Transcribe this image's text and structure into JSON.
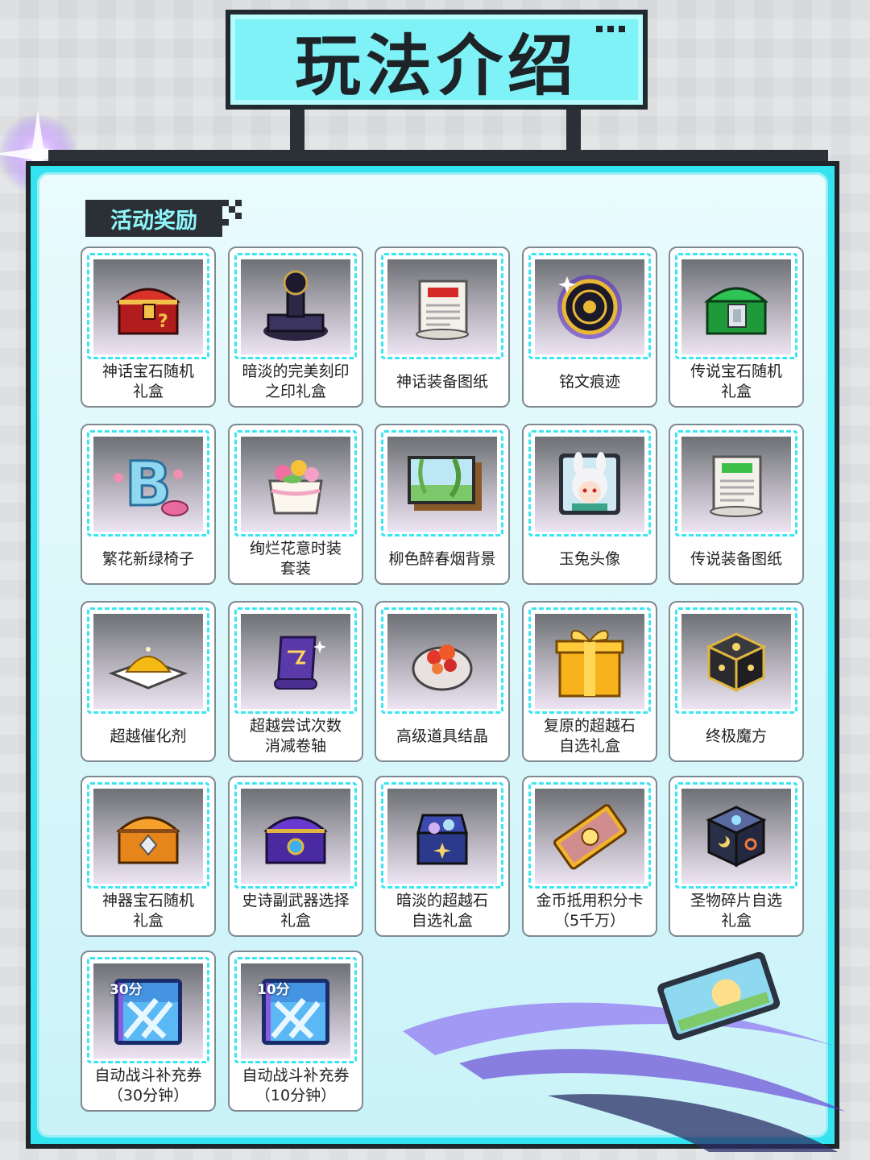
{
  "header": {
    "title": "玩法介绍"
  },
  "section": {
    "title": "活动奖励"
  },
  "rewards": [
    {
      "name": "神话宝石随机\n礼盒",
      "icon": "red-gem-chest-icon"
    },
    {
      "name": "暗淡的完美刻印\n之印礼盒",
      "icon": "dark-seal-stamp-icon"
    },
    {
      "name": "神话装备图纸",
      "icon": "red-blueprint-scroll-icon"
    },
    {
      "name": "铭文痕迹",
      "icon": "golden-inscription-orb-icon"
    },
    {
      "name": "传说宝石随机\n礼盒",
      "icon": "green-gem-chest-icon"
    },
    {
      "name": "繁花新绿椅子",
      "icon": "flower-letter-chair-icon"
    },
    {
      "name": "绚烂花意时装\n套装",
      "icon": "flower-cake-outfit-icon"
    },
    {
      "name": "柳色醉春烟背景",
      "icon": "willow-landscape-background-icon"
    },
    {
      "name": "玉兔头像",
      "icon": "jade-rabbit-avatar-icon"
    },
    {
      "name": "传说装备图纸",
      "icon": "green-blueprint-scroll-icon"
    },
    {
      "name": "超越催化剂",
      "icon": "golden-catalyst-powder-icon"
    },
    {
      "name": "超越尝试次数\n消减卷轴",
      "icon": "purple-scroll-icon"
    },
    {
      "name": "高级道具结晶",
      "icon": "item-crystal-icon"
    },
    {
      "name": "复原的超越石\n自选礼盒",
      "icon": "golden-gift-box-icon"
    },
    {
      "name": "终极魔方",
      "icon": "ultimate-cube-icon"
    },
    {
      "name": "神器宝石随机\n礼盒",
      "icon": "orange-gem-chest-icon"
    },
    {
      "name": "史诗副武器选择\n礼盒",
      "icon": "purple-weapon-chest-icon"
    },
    {
      "name": "暗淡的超越石\n自选礼盒",
      "icon": "dark-stone-box-icon"
    },
    {
      "name": "金币抵用积分卡\n（5千万）",
      "icon": "gold-coupon-card-icon"
    },
    {
      "name": "圣物碎片自选\n礼盒",
      "icon": "relic-fragment-box-icon"
    },
    {
      "name": "自动战斗补充券\n（30分钟）",
      "icon": "auto-battle-ticket-30-icon",
      "badge": "30分"
    },
    {
      "name": "自动战斗补充券\n（10分钟）",
      "icon": "auto-battle-ticket-10-icon",
      "badge": "10分"
    }
  ]
}
